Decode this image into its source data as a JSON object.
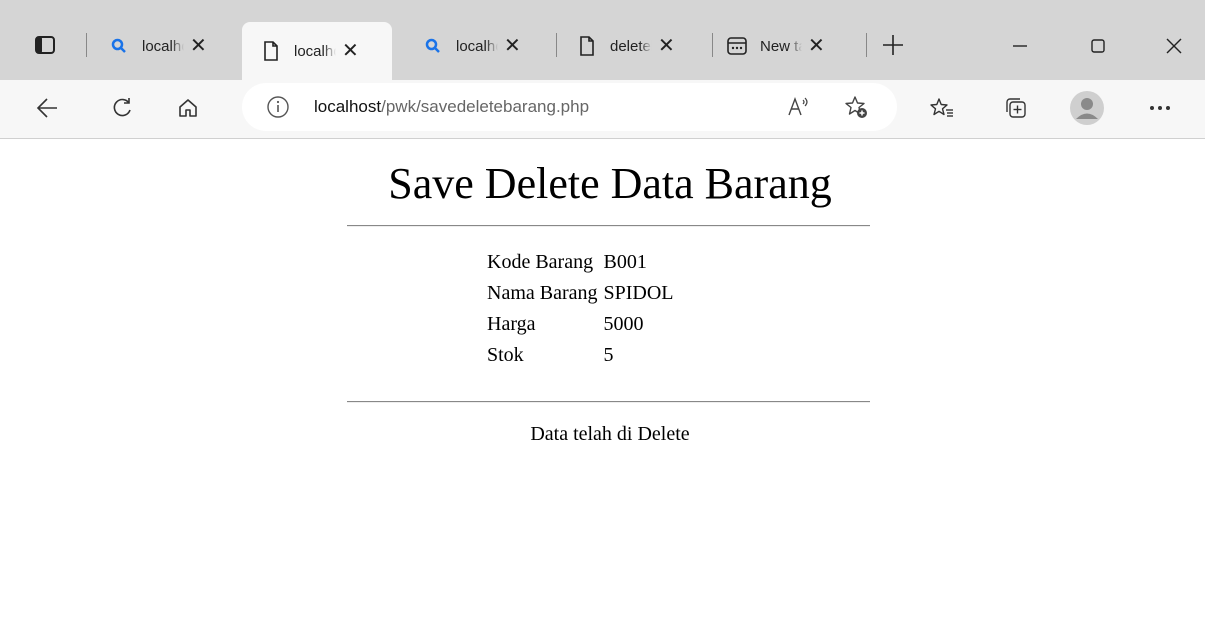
{
  "browser": {
    "tabs": [
      {
        "label": "localhost/pwk/delete.php",
        "icon": "search-icon"
      },
      {
        "label": "localhost/pwk/savedeletebarang.php",
        "icon": "page-icon"
      },
      {
        "label": "localhost/pwk/search.php",
        "icon": "search-icon"
      },
      {
        "label": "deletebarang.php",
        "icon": "page-icon"
      },
      {
        "label": "New tab",
        "icon": "newtab-icon"
      }
    ],
    "address_host": "localhost",
    "address_path": "/pwk/savedeletebarang.php",
    "accent_color": "#1a73e8"
  },
  "page": {
    "title": "Save Delete Data Barang",
    "fields": [
      {
        "label": "Kode Barang",
        "value": "B001"
      },
      {
        "label": "Nama Barang",
        "value": "SPIDOL"
      },
      {
        "label": "Harga",
        "value": "5000"
      },
      {
        "label": "Stok",
        "value": "5"
      }
    ],
    "message": "Data telah di Delete"
  }
}
